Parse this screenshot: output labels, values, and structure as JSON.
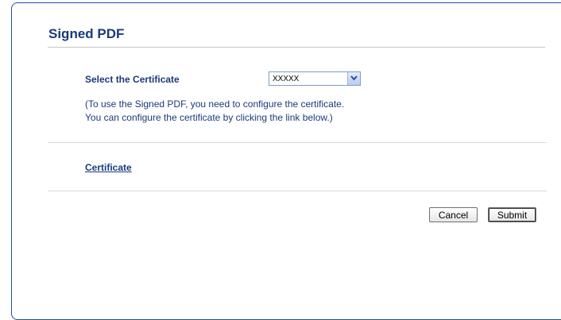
{
  "page": {
    "title": "Signed PDF"
  },
  "certificate_select": {
    "label": "Select the Certificate",
    "selected_value": "XXXXX"
  },
  "help": {
    "line1": "(To use the Signed PDF, you need to configure the certificate.",
    "line2": "You can configure the certificate by clicking the link below.)"
  },
  "links": {
    "certificate": "Certificate"
  },
  "buttons": {
    "cancel": "Cancel",
    "submit": "Submit"
  },
  "colors": {
    "heading": "#1a3a7c",
    "frame_border": "#1f4e9e"
  },
  "icons": {
    "dropdown": "chevron-down-icon"
  }
}
